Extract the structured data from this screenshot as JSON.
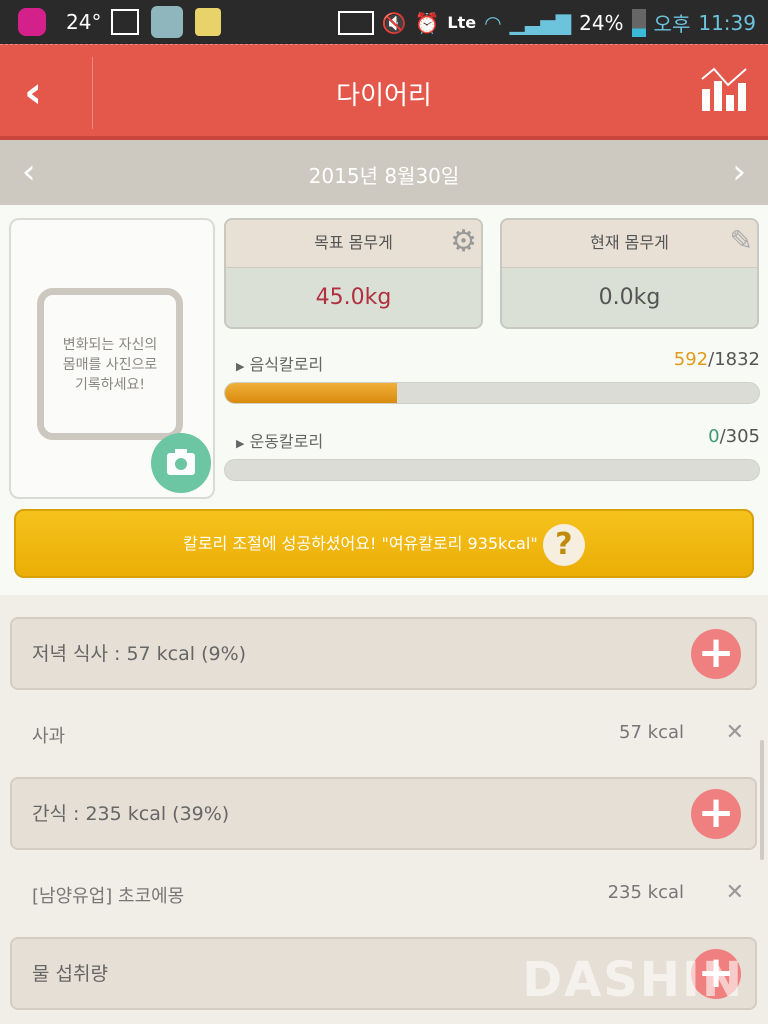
{
  "status": {
    "temp": "24°",
    "battery": "24%",
    "ampm": "오후",
    "time": "11:39",
    "network": "Lte"
  },
  "header": {
    "title": "다이어리",
    "back": "‹"
  },
  "date": {
    "label": "2015년 8월30일",
    "prev": "‹",
    "next": "›"
  },
  "photo": {
    "prompt_lines": [
      "변화되는 자신의",
      "몸매를 사진으로",
      "기록하세요!"
    ]
  },
  "target_weight": {
    "label": "목표 몸무게",
    "value": "45.0kg",
    "color": "#b03040"
  },
  "current_weight": {
    "label": "현재 몸무게",
    "value": "0.0kg"
  },
  "food_calories": {
    "label": "음식칼로리",
    "current": "592",
    "goal": "/1832",
    "progress": 0.323,
    "color": "#e29a1a"
  },
  "exercise_calories": {
    "label": "운동칼로리",
    "current": "0",
    "goal": "/305",
    "progress": 0,
    "color": "#3f9a78"
  },
  "banner": {
    "text": "칼로리 조절에 성공하셨어요! \"여유칼로리 935kcal\"",
    "help": "?"
  },
  "sections": [
    {
      "title": "저녁 식사 : 57 kcal (9%)",
      "items": [
        {
          "name": "사과",
          "kcal": "57 kcal"
        }
      ]
    },
    {
      "title": "간식 : 235 kcal (39%)",
      "items": [
        {
          "name": "[남양유업] 초코에몽",
          "kcal": "235 kcal"
        }
      ]
    },
    {
      "title": "물 섭취량",
      "items": []
    }
  ],
  "watermark": "DASHIN"
}
